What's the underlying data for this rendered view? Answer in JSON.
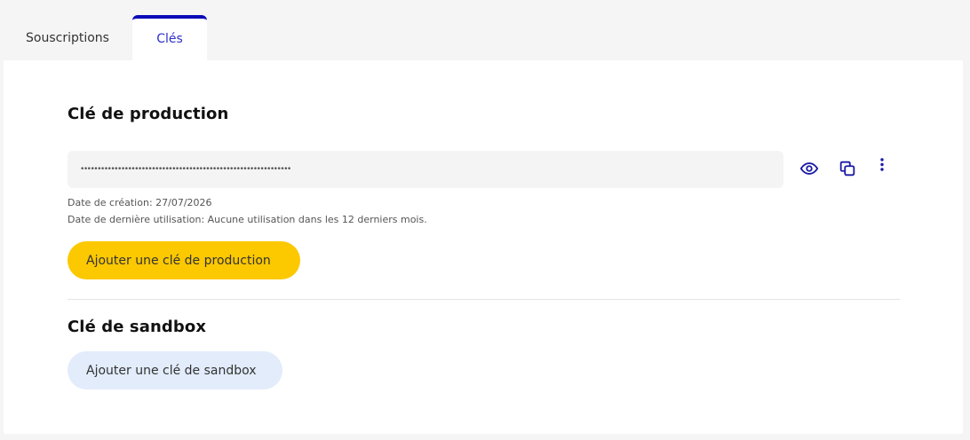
{
  "tabs": [
    {
      "label": "Souscriptions",
      "active": false
    },
    {
      "label": "Clés",
      "active": true
    }
  ],
  "production": {
    "title": "Clé de production",
    "key_masked": "••••••••••••••••••••••••••••••••••••••••••••••••••••••••••••••",
    "created": "Date de création: 27/07/2026",
    "last_used": "Date de dernière utilisation: Aucune utilisation dans les 12 derniers mois.",
    "add_button": "Ajouter une clé de production",
    "icons": [
      "eye-icon",
      "copy-icon",
      "more-vertical-icon"
    ]
  },
  "sandbox": {
    "title": "Clé de sandbox",
    "add_button": "Ajouter une clé de sandbox"
  },
  "colors": {
    "accent": "#0b0bb8",
    "primary_button": "#fcc800",
    "secondary_button": "#e2ecfb"
  }
}
